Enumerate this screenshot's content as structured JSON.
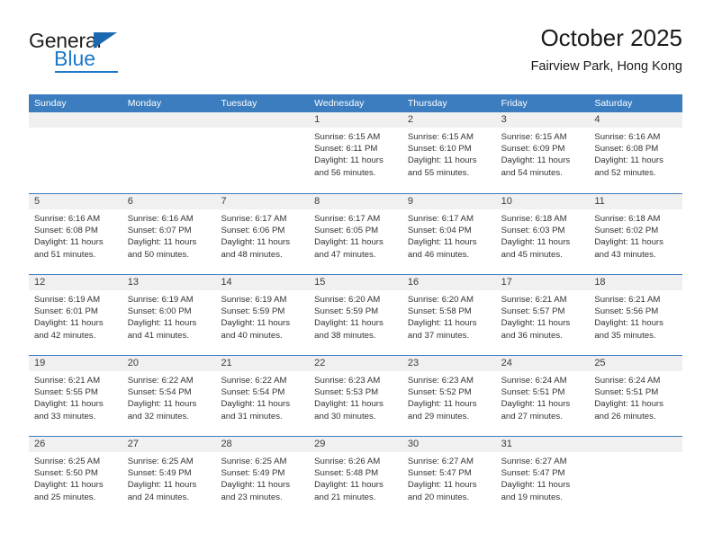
{
  "brand": {
    "name_part1": "General",
    "name_part2": "Blue",
    "triangle_color": "#1b68b0",
    "blue_color": "#1c78c8"
  },
  "header": {
    "title": "October 2025",
    "subtitle": "Fairview Park, Hong Kong"
  },
  "theme": {
    "header_blue": "#3b7dbf",
    "day_band_gray": "#f0f0f0",
    "text_dark": "#333333"
  },
  "weekdays": [
    "Sunday",
    "Monday",
    "Tuesday",
    "Wednesday",
    "Thursday",
    "Friday",
    "Saturday"
  ],
  "weeks": [
    [
      {
        "day": "",
        "lines": []
      },
      {
        "day": "",
        "lines": []
      },
      {
        "day": "",
        "lines": []
      },
      {
        "day": "1",
        "lines": [
          "Sunrise: 6:15 AM",
          "Sunset: 6:11 PM",
          "Daylight: 11 hours",
          "and 56 minutes."
        ]
      },
      {
        "day": "2",
        "lines": [
          "Sunrise: 6:15 AM",
          "Sunset: 6:10 PM",
          "Daylight: 11 hours",
          "and 55 minutes."
        ]
      },
      {
        "day": "3",
        "lines": [
          "Sunrise: 6:15 AM",
          "Sunset: 6:09 PM",
          "Daylight: 11 hours",
          "and 54 minutes."
        ]
      },
      {
        "day": "4",
        "lines": [
          "Sunrise: 6:16 AM",
          "Sunset: 6:08 PM",
          "Daylight: 11 hours",
          "and 52 minutes."
        ]
      }
    ],
    [
      {
        "day": "5",
        "lines": [
          "Sunrise: 6:16 AM",
          "Sunset: 6:08 PM",
          "Daylight: 11 hours",
          "and 51 minutes."
        ]
      },
      {
        "day": "6",
        "lines": [
          "Sunrise: 6:16 AM",
          "Sunset: 6:07 PM",
          "Daylight: 11 hours",
          "and 50 minutes."
        ]
      },
      {
        "day": "7",
        "lines": [
          "Sunrise: 6:17 AM",
          "Sunset: 6:06 PM",
          "Daylight: 11 hours",
          "and 48 minutes."
        ]
      },
      {
        "day": "8",
        "lines": [
          "Sunrise: 6:17 AM",
          "Sunset: 6:05 PM",
          "Daylight: 11 hours",
          "and 47 minutes."
        ]
      },
      {
        "day": "9",
        "lines": [
          "Sunrise: 6:17 AM",
          "Sunset: 6:04 PM",
          "Daylight: 11 hours",
          "and 46 minutes."
        ]
      },
      {
        "day": "10",
        "lines": [
          "Sunrise: 6:18 AM",
          "Sunset: 6:03 PM",
          "Daylight: 11 hours",
          "and 45 minutes."
        ]
      },
      {
        "day": "11",
        "lines": [
          "Sunrise: 6:18 AM",
          "Sunset: 6:02 PM",
          "Daylight: 11 hours",
          "and 43 minutes."
        ]
      }
    ],
    [
      {
        "day": "12",
        "lines": [
          "Sunrise: 6:19 AM",
          "Sunset: 6:01 PM",
          "Daylight: 11 hours",
          "and 42 minutes."
        ]
      },
      {
        "day": "13",
        "lines": [
          "Sunrise: 6:19 AM",
          "Sunset: 6:00 PM",
          "Daylight: 11 hours",
          "and 41 minutes."
        ]
      },
      {
        "day": "14",
        "lines": [
          "Sunrise: 6:19 AM",
          "Sunset: 5:59 PM",
          "Daylight: 11 hours",
          "and 40 minutes."
        ]
      },
      {
        "day": "15",
        "lines": [
          "Sunrise: 6:20 AM",
          "Sunset: 5:59 PM",
          "Daylight: 11 hours",
          "and 38 minutes."
        ]
      },
      {
        "day": "16",
        "lines": [
          "Sunrise: 6:20 AM",
          "Sunset: 5:58 PM",
          "Daylight: 11 hours",
          "and 37 minutes."
        ]
      },
      {
        "day": "17",
        "lines": [
          "Sunrise: 6:21 AM",
          "Sunset: 5:57 PM",
          "Daylight: 11 hours",
          "and 36 minutes."
        ]
      },
      {
        "day": "18",
        "lines": [
          "Sunrise: 6:21 AM",
          "Sunset: 5:56 PM",
          "Daylight: 11 hours",
          "and 35 minutes."
        ]
      }
    ],
    [
      {
        "day": "19",
        "lines": [
          "Sunrise: 6:21 AM",
          "Sunset: 5:55 PM",
          "Daylight: 11 hours",
          "and 33 minutes."
        ]
      },
      {
        "day": "20",
        "lines": [
          "Sunrise: 6:22 AM",
          "Sunset: 5:54 PM",
          "Daylight: 11 hours",
          "and 32 minutes."
        ]
      },
      {
        "day": "21",
        "lines": [
          "Sunrise: 6:22 AM",
          "Sunset: 5:54 PM",
          "Daylight: 11 hours",
          "and 31 minutes."
        ]
      },
      {
        "day": "22",
        "lines": [
          "Sunrise: 6:23 AM",
          "Sunset: 5:53 PM",
          "Daylight: 11 hours",
          "and 30 minutes."
        ]
      },
      {
        "day": "23",
        "lines": [
          "Sunrise: 6:23 AM",
          "Sunset: 5:52 PM",
          "Daylight: 11 hours",
          "and 29 minutes."
        ]
      },
      {
        "day": "24",
        "lines": [
          "Sunrise: 6:24 AM",
          "Sunset: 5:51 PM",
          "Daylight: 11 hours",
          "and 27 minutes."
        ]
      },
      {
        "day": "25",
        "lines": [
          "Sunrise: 6:24 AM",
          "Sunset: 5:51 PM",
          "Daylight: 11 hours",
          "and 26 minutes."
        ]
      }
    ],
    [
      {
        "day": "26",
        "lines": [
          "Sunrise: 6:25 AM",
          "Sunset: 5:50 PM",
          "Daylight: 11 hours",
          "and 25 minutes."
        ]
      },
      {
        "day": "27",
        "lines": [
          "Sunrise: 6:25 AM",
          "Sunset: 5:49 PM",
          "Daylight: 11 hours",
          "and 24 minutes."
        ]
      },
      {
        "day": "28",
        "lines": [
          "Sunrise: 6:25 AM",
          "Sunset: 5:49 PM",
          "Daylight: 11 hours",
          "and 23 minutes."
        ]
      },
      {
        "day": "29",
        "lines": [
          "Sunrise: 6:26 AM",
          "Sunset: 5:48 PM",
          "Daylight: 11 hours",
          "and 21 minutes."
        ]
      },
      {
        "day": "30",
        "lines": [
          "Sunrise: 6:27 AM",
          "Sunset: 5:47 PM",
          "Daylight: 11 hours",
          "and 20 minutes."
        ]
      },
      {
        "day": "31",
        "lines": [
          "Sunrise: 6:27 AM",
          "Sunset: 5:47 PM",
          "Daylight: 11 hours",
          "and 19 minutes."
        ]
      },
      {
        "day": "",
        "lines": []
      }
    ]
  ]
}
